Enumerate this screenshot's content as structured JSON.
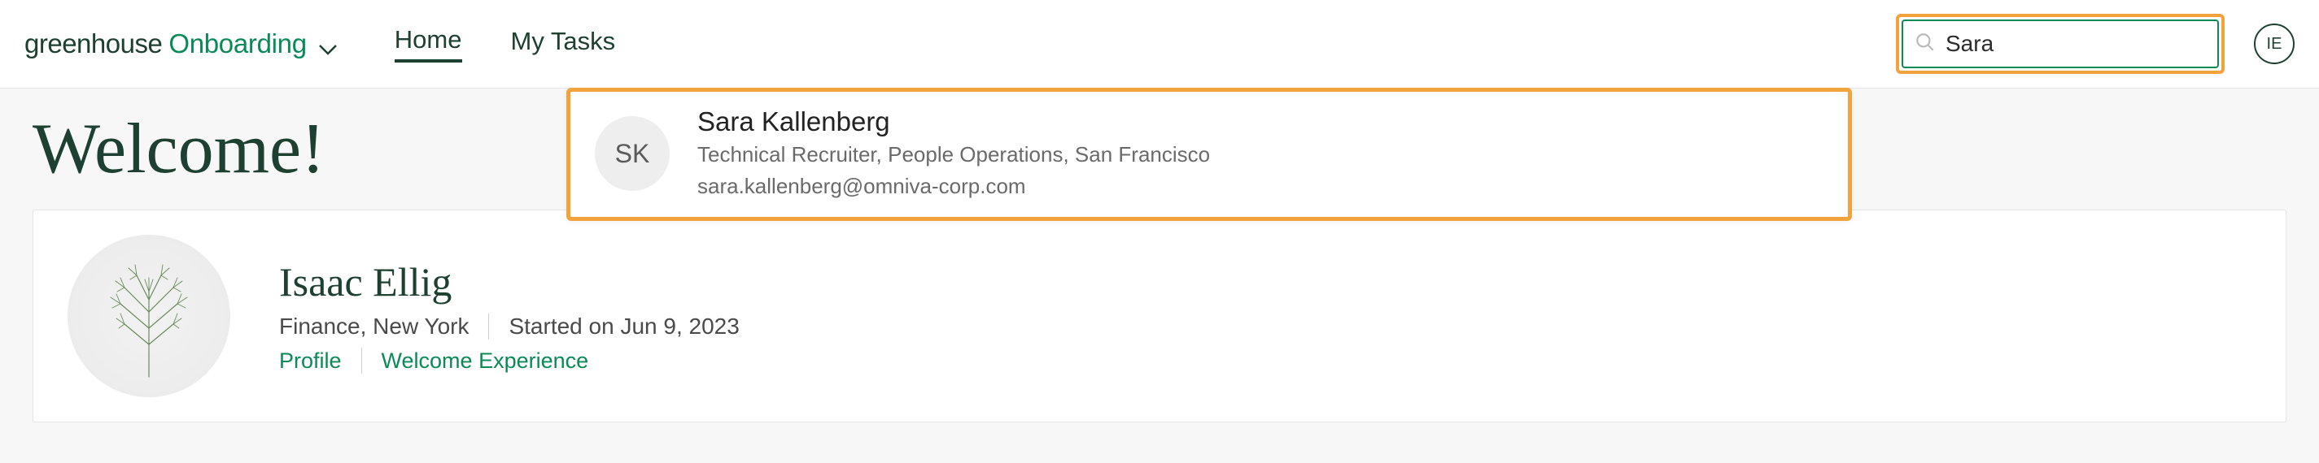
{
  "brand": {
    "greenhouse": "greenhouse",
    "onboarding": "Onboarding"
  },
  "nav": {
    "home": "Home",
    "my_tasks": "My Tasks"
  },
  "search": {
    "value": "Sara"
  },
  "current_user": {
    "initials": "IE"
  },
  "page": {
    "welcome_title": "Welcome!"
  },
  "profile": {
    "name": "Isaac Ellig",
    "meta_location": "Finance, New York",
    "meta_started": "Started on Jun 9, 2023",
    "link_profile": "Profile",
    "link_welcome": "Welcome Experience"
  },
  "search_result": {
    "initials": "SK",
    "name": "Sara Kallenberg",
    "role": "Technical Recruiter, People Operations, San Francisco",
    "email": "sara.kallenberg@omniva-corp.com"
  }
}
